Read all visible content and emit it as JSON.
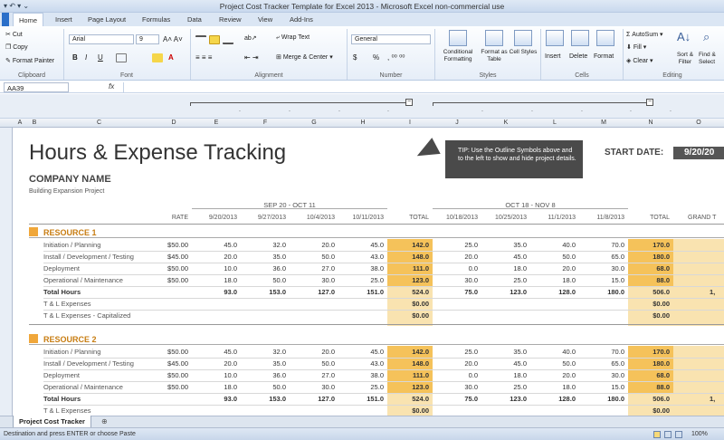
{
  "window": {
    "title": "Project Cost Tracker Template for Excel 2013 - Microsoft Excel non-commercial use"
  },
  "tabs": [
    "Home",
    "Insert",
    "Page Layout",
    "Formulas",
    "Data",
    "Review",
    "View",
    "Add-Ins"
  ],
  "ribbon": {
    "clipboard": {
      "cut": "Cut",
      "copy": "Copy",
      "format_painter": "Format Painter",
      "label": "Clipboard"
    },
    "font": {
      "name": "Arial",
      "size": "9",
      "bold": "B",
      "italic": "I",
      "underline": "U",
      "label": "Font"
    },
    "alignment": {
      "wrap": "Wrap Text",
      "merge": "Merge & Center",
      "label": "Alignment"
    },
    "number": {
      "format": "General",
      "currency": "$",
      "percent": "%",
      "label": "Number"
    },
    "styles": {
      "conditional": "Conditional Formatting",
      "format_table": "Format as Table",
      "cell_styles": "Cell Styles",
      "label": "Styles"
    },
    "cells": {
      "insert": "Insert",
      "delete": "Delete",
      "format": "Format",
      "label": "Cells"
    },
    "editing": {
      "autosum": "AutoSum",
      "fill": "Fill",
      "clear": "Clear",
      "sort": "Sort & Filter",
      "find": "Find & Select",
      "label": "Editing"
    }
  },
  "formula_bar": {
    "name_box": "AA39",
    "fx": "fx",
    "value": ""
  },
  "columns": [
    "A",
    "B",
    "C",
    "D",
    "E",
    "F",
    "G",
    "H",
    "I",
    "J",
    "K",
    "L",
    "M",
    "N",
    "O"
  ],
  "rows": [
    "",
    "",
    "",
    "",
    "",
    "",
    "",
    "",
    "",
    "",
    "",
    "",
    "",
    "",
    "",
    "",
    "",
    "",
    "",
    "",
    "",
    "",
    "",
    "",
    ""
  ],
  "sheet": {
    "title": "Hours & Expense Tracking",
    "company": "COMPANY NAME",
    "project": "Building Expansion Project",
    "start_label": "START DATE:",
    "start_value": "9/20/20",
    "tip": "TIP: Use the Outline Symbols above and to the left to show and hide project details.",
    "period1": "SEP 20 - OCT 11",
    "period2": "OCT 18 - NOV 8",
    "headers": [
      "RATE",
      "9/20/2013",
      "9/27/2013",
      "10/4/2013",
      "10/11/2013",
      "TOTAL",
      "10/18/2013",
      "10/25/2013",
      "11/1/2013",
      "11/8/2013",
      "TOTAL",
      "GRAND T"
    ],
    "resources": [
      {
        "name": "RESOURCE 1",
        "tasks": [
          {
            "label": "Initiation / Planning",
            "rate": "$50.00",
            "p1": [
              "45.0",
              "32.0",
              "20.0",
              "45.0"
            ],
            "t1": "142.0",
            "p2": [
              "25.0",
              "35.0",
              "40.0",
              "70.0"
            ],
            "t2": "170.0"
          },
          {
            "label": "Install / Development / Testing",
            "rate": "$45.00",
            "p1": [
              "20.0",
              "35.0",
              "50.0",
              "43.0"
            ],
            "t1": "148.0",
            "p2": [
              "20.0",
              "45.0",
              "50.0",
              "65.0"
            ],
            "t2": "180.0"
          },
          {
            "label": "Deployment",
            "rate": "$50.00",
            "p1": [
              "10.0",
              "36.0",
              "27.0",
              "38.0"
            ],
            "t1": "111.0",
            "p2": [
              "0.0",
              "18.0",
              "20.0",
              "30.0"
            ],
            "t2": "68.0"
          },
          {
            "label": "Operational / Maintenance",
            "rate": "$50.00",
            "p1": [
              "18.0",
              "50.0",
              "30.0",
              "25.0"
            ],
            "t1": "123.0",
            "p2": [
              "30.0",
              "25.0",
              "18.0",
              "15.0"
            ],
            "t2": "88.0"
          }
        ],
        "total_label": "Total Hours",
        "totals_p1": [
          "93.0",
          "153.0",
          "127.0",
          "151.0"
        ],
        "total1": "524.0",
        "totals_p2": [
          "75.0",
          "123.0",
          "128.0",
          "180.0"
        ],
        "total2": "506.0",
        "grand": "1,",
        "exp_label": "T & L Expenses",
        "exp1": "$0.00",
        "exp2": "$0.00",
        "cap_label": "T & L Expenses - Capitalized",
        "cap1": "$0.00",
        "cap2": "$0.00"
      },
      {
        "name": "RESOURCE 2",
        "tasks": [
          {
            "label": "Initiation / Planning",
            "rate": "$50.00",
            "p1": [
              "45.0",
              "32.0",
              "20.0",
              "45.0"
            ],
            "t1": "142.0",
            "p2": [
              "25.0",
              "35.0",
              "40.0",
              "70.0"
            ],
            "t2": "170.0"
          },
          {
            "label": "Install / Development / Testing",
            "rate": "$45.00",
            "p1": [
              "20.0",
              "35.0",
              "50.0",
              "43.0"
            ],
            "t1": "148.0",
            "p2": [
              "20.0",
              "45.0",
              "50.0",
              "65.0"
            ],
            "t2": "180.0"
          },
          {
            "label": "Deployment",
            "rate": "$50.00",
            "p1": [
              "10.0",
              "36.0",
              "27.0",
              "38.0"
            ],
            "t1": "111.0",
            "p2": [
              "0.0",
              "18.0",
              "20.0",
              "30.0"
            ],
            "t2": "68.0"
          },
          {
            "label": "Operational / Maintenance",
            "rate": "$50.00",
            "p1": [
              "18.0",
              "50.0",
              "30.0",
              "25.0"
            ],
            "t1": "123.0",
            "p2": [
              "30.0",
              "25.0",
              "18.0",
              "15.0"
            ],
            "t2": "88.0"
          }
        ],
        "total_label": "Total Hours",
        "totals_p1": [
          "93.0",
          "153.0",
          "127.0",
          "151.0"
        ],
        "total1": "524.0",
        "totals_p2": [
          "75.0",
          "123.0",
          "128.0",
          "180.0"
        ],
        "total2": "506.0",
        "grand": "1,",
        "exp_label": "T & L Expenses",
        "exp1": "$0.00",
        "exp2": "$0.00"
      }
    ]
  },
  "sheet_tab": "Project Cost Tracker",
  "status": {
    "text": "Destination and press ENTER or choose Paste",
    "zoom": "100%"
  }
}
